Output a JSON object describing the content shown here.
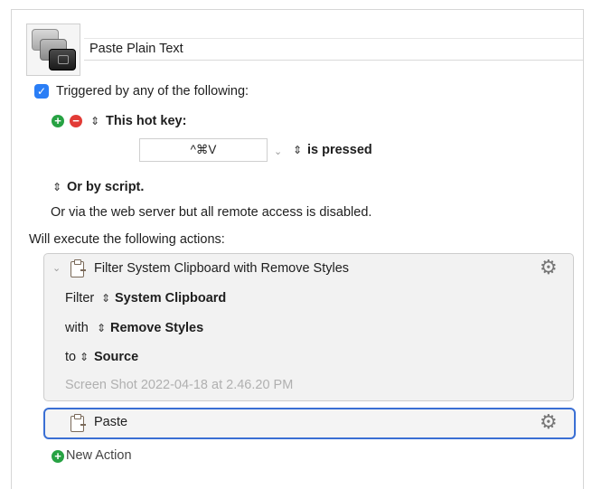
{
  "macro": {
    "name": "Paste Plain Text"
  },
  "triggers": {
    "checkbox_checked": true,
    "header": "Triggered by any of the following:",
    "hotkey_label": "This hot key:",
    "hotkey_value": "^⌘V",
    "pressed_label": "is pressed",
    "script_label": "Or by script.",
    "webserver_note": "Or via the web server but all remote access is disabled."
  },
  "actions": {
    "header": "Will execute the following actions:",
    "items": [
      {
        "title": "Filter System Clipboard with Remove Styles",
        "filter_prefix": "Filter",
        "filter_value": "System Clipboard",
        "with_prefix": "with",
        "with_value": "Remove Styles",
        "to_prefix": "to",
        "to_value": "Source",
        "preview": "Screen Shot 2022-04-18 at 2.46.20 PM"
      },
      {
        "title": "Paste"
      }
    ],
    "new_action_label": "New Action"
  },
  "colors": {
    "accent": "#2a7ef6",
    "add": "#27a243",
    "remove": "#e23b36",
    "selected_border": "#3a6fd4"
  }
}
